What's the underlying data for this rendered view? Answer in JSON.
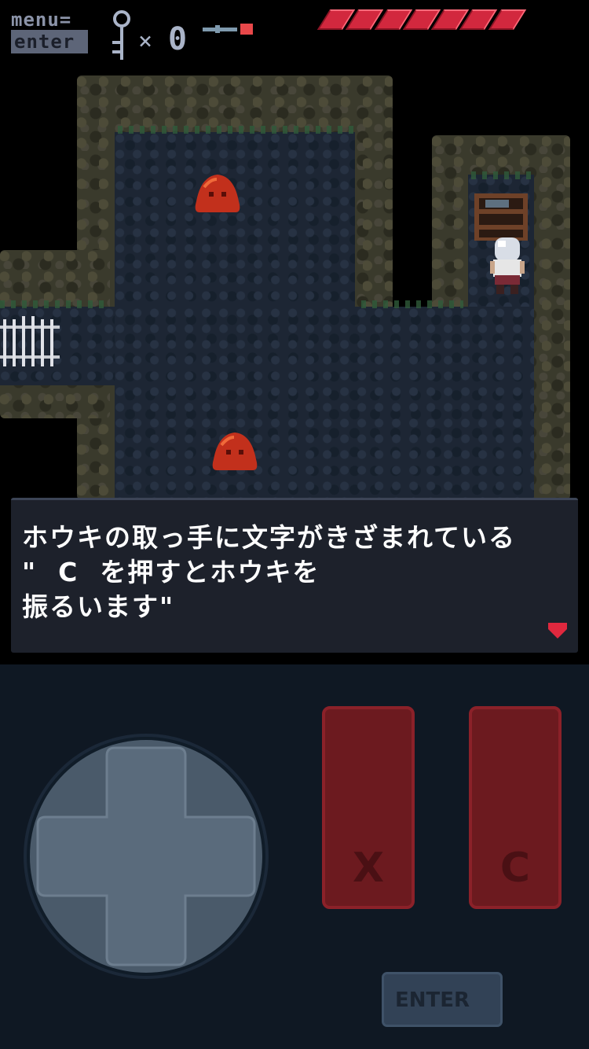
{
  "hud": {
    "menu_line1": "menu=",
    "menu_line2": "enter",
    "key_times": "×",
    "key_count": "0",
    "health_segments": 7
  },
  "dialog": {
    "lines": [
      "ホウキの取っ手に文字がきざまれている",
      "\"  C  を押すとホウキを",
      "振るいます\""
    ],
    "next_indicator": "next-arrow-icon"
  },
  "controls": {
    "x_label": "X",
    "c_label": "C",
    "enter_label": "ENTER",
    "dpad": "dpad-icon"
  },
  "colors": {
    "health": "#d2283e",
    "slime": "#c2301c",
    "button_red": "#6c1a1f",
    "controller_bg": "#0f1823"
  }
}
